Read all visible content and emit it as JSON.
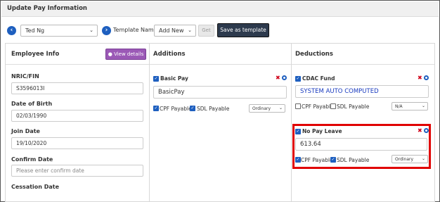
{
  "title": "Update Pay Information",
  "toolbar": {
    "employee": "Ted Ng",
    "template_label": "Template Name",
    "template_value": "Add New",
    "get_label": "Get",
    "save_template_label": "Save as template"
  },
  "employee_info": {
    "title": "Employee Info",
    "view_details": "View details",
    "nric_label": "NRIC/FIN",
    "nric_value": "S3596013I",
    "dob_label": "Date of Birth",
    "dob_value": "02/03/1990",
    "join_label": "Join Date",
    "join_value": "19/10/2020",
    "confirm_label": "Confirm Date",
    "confirm_placeholder": "Please enter confirm date",
    "cessation_label": "Cessation Date"
  },
  "additions": {
    "title": "Additions",
    "item_label": "Basic Pay",
    "item_value": "BasicPay",
    "cpf_label": "CPF Payable",
    "sdl_label": "SDL Payable",
    "select_value": "Ordinary"
  },
  "deductions": {
    "title": "Deductions",
    "items": [
      {
        "label": "CDAC Fund",
        "value": "SYSTEM AUTO COMPUTED",
        "cpf_label": "CPF Payable",
        "sdl_label": "SDL Payable",
        "select_value": "N/A"
      },
      {
        "label": "No Pay Leave",
        "value": "613.64",
        "cpf_label": "CPF Payable",
        "sdl_label": "SDL Payable",
        "select_value": "Ordinary"
      }
    ]
  },
  "colors": {
    "primary": "#1e5fbf",
    "purple_button": "#9b59b6",
    "dark_button": "#2d3a4d",
    "highlight": "#e00000",
    "remove": "#d0021b"
  }
}
